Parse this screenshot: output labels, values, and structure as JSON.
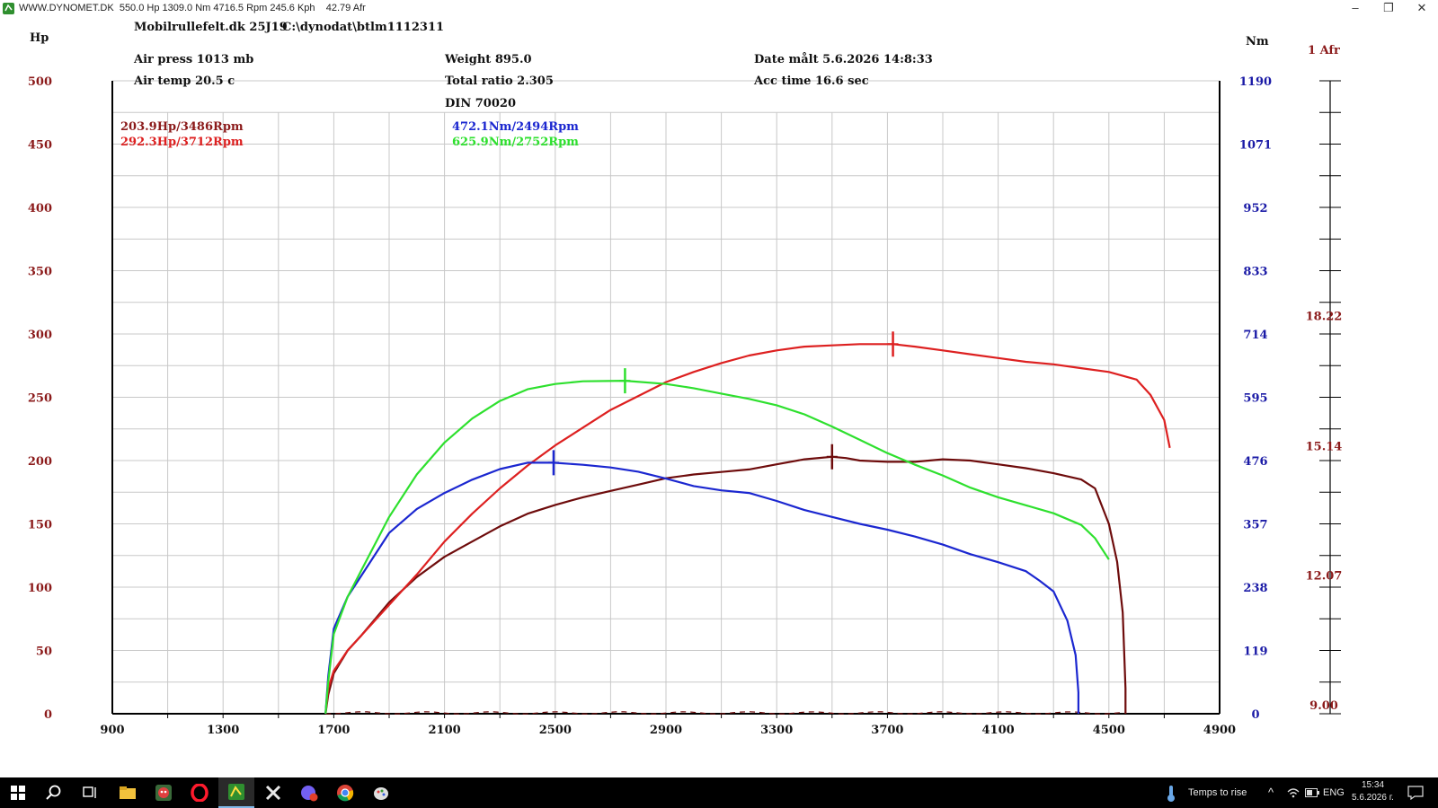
{
  "window": {
    "title": "WWW.DYNOMET.DK  550.0 Hp 1309.0 Nm 4716.5 Rpm 245.6 Kph    42.79 Afr"
  },
  "header": {
    "device": "Mobilrullefelt.dk 25J19",
    "path": "C:\\dynodat\\btlm1112311",
    "air_press": "Air press  1013 mb",
    "air_temp": "Air temp  20.5 c",
    "weight": "Weight   895.0",
    "total_ratio": "Total ratio 2.305",
    "din": "DIN 70020",
    "date": "Date målt 5.6.2026 14:8:33",
    "acc_time": "Acc time   16.6 sec"
  },
  "peaks": {
    "hp1": "203.9Hp/3486Rpm",
    "hp2": "292.3Hp/3712Rpm",
    "nm1": "472.1Nm/2494Rpm",
    "nm2": "625.9Nm/2752Rpm"
  },
  "colors": {
    "hp_axis": "#8b1a1a",
    "nm_axis": "#1a1aa6",
    "afr_axis": "#8b1a1a",
    "hp_run1": "#6e0c0c",
    "hp_run2": "#dd2020",
    "nm_run1": "#1b27d0",
    "nm_run2": "#2ee02e",
    "grid": "#c8c8c8"
  },
  "chart_data": {
    "type": "line",
    "xlim": [
      900,
      4900
    ],
    "x_ticks": [
      900,
      1300,
      1700,
      2100,
      2500,
      2900,
      3300,
      3700,
      4100,
      4500,
      4900
    ],
    "y_left": {
      "label": "Hp",
      "ylim": [
        0,
        500
      ],
      "ticks": [
        0,
        50,
        100,
        150,
        200,
        250,
        300,
        350,
        400,
        450,
        500
      ]
    },
    "y_right": {
      "label": "Nm",
      "ylim": [
        0,
        1190
      ],
      "ticks": [
        0,
        119,
        238,
        357,
        476,
        595,
        714,
        833,
        952,
        1071,
        1190
      ]
    },
    "y_afr": {
      "label": "1 Afr",
      "ylim": [
        9,
        24
      ],
      "ticks": [
        9.0,
        12.07,
        15.14,
        18.22
      ]
    },
    "grid": true,
    "series": [
      {
        "axis": "left",
        "color_key": "hp_run1",
        "marker": [
          3500,
          203
        ],
        "points": [
          [
            1670,
            0
          ],
          [
            1680,
            15
          ],
          [
            1700,
            32
          ],
          [
            1750,
            50
          ],
          [
            1800,
            62
          ],
          [
            1850,
            75
          ],
          [
            1900,
            88
          ],
          [
            2000,
            108
          ],
          [
            2100,
            124
          ],
          [
            2200,
            136
          ],
          [
            2300,
            148
          ],
          [
            2400,
            158
          ],
          [
            2500,
            165
          ],
          [
            2600,
            171
          ],
          [
            2700,
            176
          ],
          [
            2800,
            181
          ],
          [
            2900,
            186
          ],
          [
            3000,
            189
          ],
          [
            3100,
            191
          ],
          [
            3200,
            193
          ],
          [
            3300,
            197
          ],
          [
            3400,
            201
          ],
          [
            3500,
            203
          ],
          [
            3550,
            202
          ],
          [
            3600,
            200
          ],
          [
            3700,
            199
          ],
          [
            3800,
            199
          ],
          [
            3900,
            201
          ],
          [
            4000,
            200
          ],
          [
            4100,
            197
          ],
          [
            4200,
            194
          ],
          [
            4300,
            190
          ],
          [
            4400,
            185
          ],
          [
            4450,
            178
          ],
          [
            4500,
            150
          ],
          [
            4530,
            120
          ],
          [
            4550,
            80
          ],
          [
            4560,
            20
          ],
          [
            4560,
            0
          ]
        ]
      },
      {
        "axis": "left",
        "color_key": "hp_run2",
        "marker": [
          3720,
          292
        ],
        "points": [
          [
            1670,
            0
          ],
          [
            1680,
            20
          ],
          [
            1700,
            34
          ],
          [
            1750,
            50
          ],
          [
            1800,
            62
          ],
          [
            1900,
            86
          ],
          [
            2000,
            110
          ],
          [
            2100,
            136
          ],
          [
            2200,
            158
          ],
          [
            2300,
            178
          ],
          [
            2400,
            196
          ],
          [
            2500,
            212
          ],
          [
            2600,
            226
          ],
          [
            2700,
            240
          ],
          [
            2800,
            251
          ],
          [
            2900,
            262
          ],
          [
            3000,
            270
          ],
          [
            3100,
            277
          ],
          [
            3200,
            283
          ],
          [
            3300,
            287
          ],
          [
            3400,
            290
          ],
          [
            3500,
            291
          ],
          [
            3600,
            292
          ],
          [
            3720,
            292
          ],
          [
            3800,
            290
          ],
          [
            3900,
            287
          ],
          [
            4000,
            284
          ],
          [
            4100,
            281
          ],
          [
            4200,
            278
          ],
          [
            4300,
            276
          ],
          [
            4400,
            273
          ],
          [
            4500,
            270
          ],
          [
            4600,
            264
          ],
          [
            4650,
            252
          ],
          [
            4700,
            232
          ],
          [
            4720,
            210
          ]
        ]
      },
      {
        "axis": "right",
        "color_key": "nm_run1",
        "marker": [
          2494,
          472
        ],
        "points": [
          [
            1670,
            0
          ],
          [
            1680,
            70
          ],
          [
            1700,
            160
          ],
          [
            1750,
            220
          ],
          [
            1800,
            260
          ],
          [
            1900,
            340
          ],
          [
            2000,
            385
          ],
          [
            2100,
            415
          ],
          [
            2200,
            440
          ],
          [
            2300,
            460
          ],
          [
            2400,
            472
          ],
          [
            2494,
            472
          ],
          [
            2600,
            468
          ],
          [
            2700,
            463
          ],
          [
            2800,
            455
          ],
          [
            2900,
            442
          ],
          [
            3000,
            428
          ],
          [
            3100,
            420
          ],
          [
            3200,
            415
          ],
          [
            3300,
            400
          ],
          [
            3400,
            383
          ],
          [
            3500,
            370
          ],
          [
            3600,
            357
          ],
          [
            3700,
            346
          ],
          [
            3800,
            333
          ],
          [
            3900,
            318
          ],
          [
            4000,
            300
          ],
          [
            4100,
            285
          ],
          [
            4200,
            268
          ],
          [
            4250,
            250
          ],
          [
            4300,
            230
          ],
          [
            4350,
            175
          ],
          [
            4380,
            110
          ],
          [
            4390,
            40
          ],
          [
            4390,
            0
          ]
        ]
      },
      {
        "axis": "right",
        "color_key": "nm_run2",
        "marker": [
          2752,
          626
        ],
        "points": [
          [
            1670,
            0
          ],
          [
            1680,
            60
          ],
          [
            1700,
            150
          ],
          [
            1750,
            220
          ],
          [
            1800,
            270
          ],
          [
            1900,
            370
          ],
          [
            2000,
            450
          ],
          [
            2100,
            510
          ],
          [
            2200,
            555
          ],
          [
            2300,
            588
          ],
          [
            2400,
            610
          ],
          [
            2500,
            620
          ],
          [
            2600,
            625
          ],
          [
            2752,
            626
          ],
          [
            2900,
            620
          ],
          [
            3000,
            612
          ],
          [
            3100,
            602
          ],
          [
            3200,
            592
          ],
          [
            3300,
            580
          ],
          [
            3400,
            563
          ],
          [
            3500,
            540
          ],
          [
            3600,
            515
          ],
          [
            3700,
            490
          ],
          [
            3800,
            468
          ],
          [
            3900,
            448
          ],
          [
            4000,
            425
          ],
          [
            4100,
            407
          ],
          [
            4200,
            392
          ],
          [
            4300,
            377
          ],
          [
            4400,
            355
          ],
          [
            4450,
            330
          ],
          [
            4500,
            290
          ]
        ]
      }
    ]
  },
  "taskbar": {
    "weather": "Temps to rise",
    "language": "ENG",
    "time": "15:34",
    "date": "5.6.2026 г."
  }
}
